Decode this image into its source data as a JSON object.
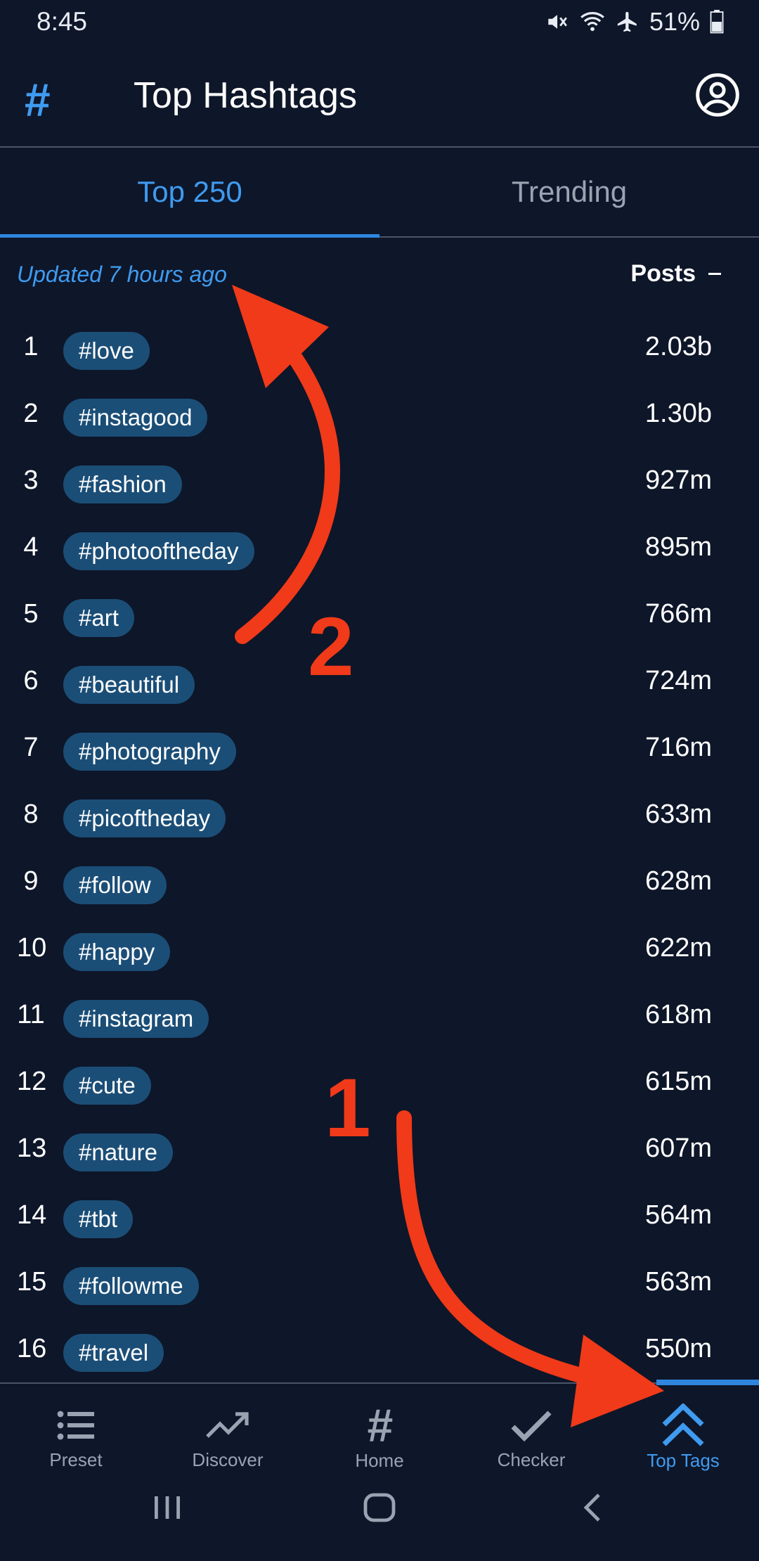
{
  "status_bar": {
    "time": "8:45",
    "battery": "51%"
  },
  "app_bar": {
    "logo": "#",
    "title": "Top Hashtags",
    "account_icon": "account-circle-icon"
  },
  "tabs": [
    {
      "label": "Top 250",
      "active": true
    },
    {
      "label": "Trending",
      "active": false
    }
  ],
  "list_header": {
    "updated": "Updated 7 hours ago",
    "posts_label": "Posts"
  },
  "hashtags": [
    {
      "rank": "1",
      "tag": "#love",
      "posts": "2.03b"
    },
    {
      "rank": "2",
      "tag": "#instagood",
      "posts": "1.30b"
    },
    {
      "rank": "3",
      "tag": "#fashion",
      "posts": "927m"
    },
    {
      "rank": "4",
      "tag": "#photooftheday",
      "posts": "895m"
    },
    {
      "rank": "5",
      "tag": "#art",
      "posts": "766m"
    },
    {
      "rank": "6",
      "tag": "#beautiful",
      "posts": "724m"
    },
    {
      "rank": "7",
      "tag": "#photography",
      "posts": "716m"
    },
    {
      "rank": "8",
      "tag": "#picoftheday",
      "posts": "633m"
    },
    {
      "rank": "9",
      "tag": "#follow",
      "posts": "628m"
    },
    {
      "rank": "10",
      "tag": "#happy",
      "posts": "622m"
    },
    {
      "rank": "11",
      "tag": "#instagram",
      "posts": "618m"
    },
    {
      "rank": "12",
      "tag": "#cute",
      "posts": "615m"
    },
    {
      "rank": "13",
      "tag": "#nature",
      "posts": "607m"
    },
    {
      "rank": "14",
      "tag": "#tbt",
      "posts": "564m"
    },
    {
      "rank": "15",
      "tag": "#followme",
      "posts": "563m"
    },
    {
      "rank": "16",
      "tag": "#travel",
      "posts": "550m"
    }
  ],
  "bottom_nav": [
    {
      "label": "Preset",
      "icon": "list-icon",
      "active": false
    },
    {
      "label": "Discover",
      "icon": "trending-up-icon",
      "active": false
    },
    {
      "label": "Home",
      "icon": "hashtag-icon",
      "active": false
    },
    {
      "label": "Checker",
      "icon": "checkmark-icon",
      "active": false
    },
    {
      "label": "Top Tags",
      "icon": "double-chevron-up-icon",
      "active": true
    }
  ],
  "annotations": {
    "step_1": "1",
    "step_2": "2",
    "color": "#f03a19"
  },
  "colors": {
    "background": "#0e1629",
    "accent": "#3f9bf0",
    "chip": "#1b4e77",
    "muted": "#9aa3b2"
  }
}
